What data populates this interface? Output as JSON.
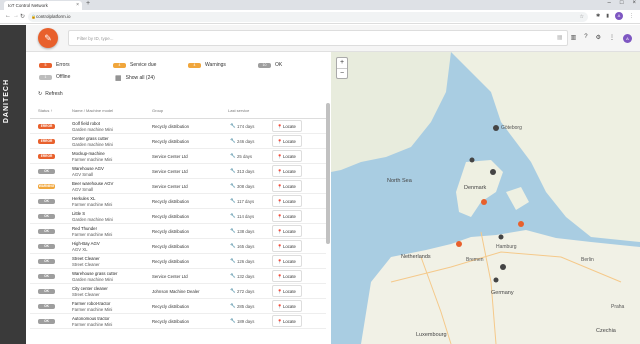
{
  "browser": {
    "tab_title": "IoT Control Network",
    "url": "controlplatform.io",
    "profile_initial": "A"
  },
  "app": {
    "brand": "DANITECH",
    "filter_placeholder": "Filter by ID, type...",
    "user_initial": "A",
    "accent_color": "#e8602c"
  },
  "legend": {
    "errors": {
      "count": "5",
      "label": "Errors",
      "color": "#e8602c"
    },
    "service_due": {
      "count": "4",
      "label": "Service due",
      "color": "#f0a63c"
    },
    "warnings": {
      "count": "4",
      "label": "Warnings",
      "color": "#f0a63c"
    },
    "ok": {
      "count": "10",
      "label": "OK",
      "color": "#9e9e9e"
    },
    "offline": {
      "count": "1",
      "label": "Offline",
      "color": "#bdbdbd"
    },
    "show_all": "Show all (24)",
    "refresh": "Refresh"
  },
  "table": {
    "columns": [
      "Status",
      "Name / Machine model",
      "Group",
      "Last service"
    ],
    "locate_label": "Locate",
    "rows": [
      {
        "status": "ERROR",
        "color": "#e8602c",
        "name": "Golf field robot",
        "model": "Garden machine Mini",
        "group": "Recycly distribution",
        "service": "174 days"
      },
      {
        "status": "ERROR",
        "color": "#e8602c",
        "name": "Center grass cutter",
        "model": "Garden machine Mini",
        "group": "Recycly distribution",
        "service": "246 days"
      },
      {
        "status": "ERROR",
        "color": "#e8602c",
        "name": "Mockup-machine",
        "model": "Farmer machine Mini",
        "group": "Service Center Ltd",
        "service": "25 days"
      },
      {
        "status": "OK",
        "color": "#9e9e9e",
        "name": "Warehouse AGV",
        "model": "AGV Small",
        "group": "Service Center Ltd",
        "service": "313 days"
      },
      {
        "status": "WARNING",
        "color": "#f0a63c",
        "name": "Beer warehouse AGV",
        "model": "AGV Small",
        "group": "Service Center Ltd",
        "service": "308 days"
      },
      {
        "status": "OK",
        "color": "#9e9e9e",
        "name": "Herkules XL",
        "model": "Farmer machine Mini",
        "group": "Recycly distribution",
        "service": "117 days"
      },
      {
        "status": "OK",
        "color": "#9e9e9e",
        "name": "Little S",
        "model": "Garden machine Mini",
        "group": "Recycly distribution",
        "service": "114 days"
      },
      {
        "status": "OK",
        "color": "#9e9e9e",
        "name": "Red Thunder",
        "model": "Farmer machine Mini",
        "group": "Recycly distribution",
        "service": "138 days"
      },
      {
        "status": "OK",
        "color": "#9e9e9e",
        "name": "High-Bay AGV",
        "model": "AGV XL",
        "group": "Recycly distribution",
        "service": "165 days"
      },
      {
        "status": "OK",
        "color": "#9e9e9e",
        "name": "Street Cleaner",
        "model": "Street Cleaner",
        "group": "Recycly distribution",
        "service": "126 days"
      },
      {
        "status": "OK",
        "color": "#9e9e9e",
        "name": "Warehouse grass cutter",
        "model": "Garden machine Mini",
        "group": "Service Center Ltd",
        "service": "132 days"
      },
      {
        "status": "OK",
        "color": "#9e9e9e",
        "name": "City center cleaner",
        "model": "Street Cleaner",
        "group": "Johnson Machine Dealer",
        "service": "272 days"
      },
      {
        "status": "OK",
        "color": "#9e9e9e",
        "name": "Farmer robot-tractor",
        "model": "Farmer machine Mini",
        "group": "Recycly distribution",
        "service": "285 days"
      },
      {
        "status": "OK",
        "color": "#9e9e9e",
        "name": "Autonomous tractor",
        "model": "Farmer machine Mini",
        "group": "Recycly distribution",
        "service": "189 days"
      }
    ]
  },
  "map": {
    "zoom_in": "+",
    "zoom_out": "−",
    "labels": [
      "North Sea",
      "Denmark",
      "Netherlands",
      "Germany",
      "Luxembourg",
      "Czechia",
      "Göteborg",
      "Hamburg",
      "Berlin",
      "Bremen",
      "Praha"
    ]
  }
}
